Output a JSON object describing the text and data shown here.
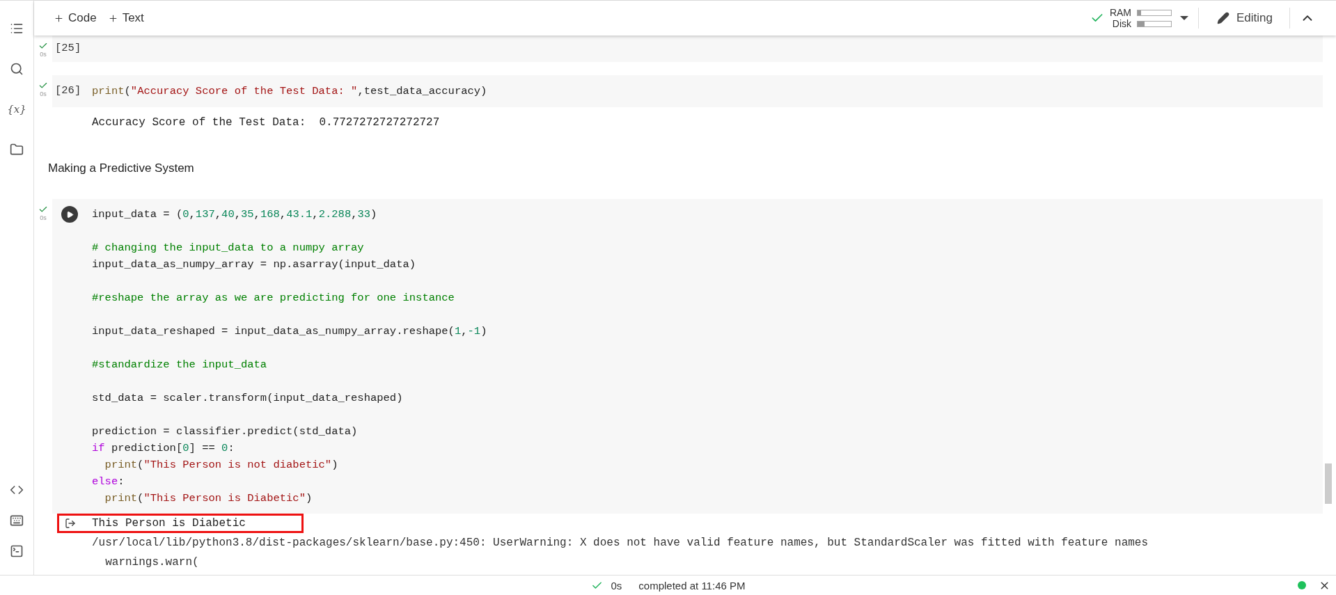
{
  "toolbar": {
    "add_buttons": [
      {
        "label": "Code"
      },
      {
        "label": "Text"
      }
    ],
    "meters": [
      {
        "label": "RAM",
        "level": 0.1
      },
      {
        "label": "Disk",
        "level": 0.2
      }
    ],
    "mode": "Editing"
  },
  "sidebar": {
    "top": [
      {
        "kind": "toc"
      },
      {
        "kind": "search"
      },
      {
        "kind": "variables",
        "label": "{x}"
      },
      {
        "kind": "files"
      }
    ],
    "bottom": [
      {
        "kind": "code"
      },
      {
        "kind": "command"
      },
      {
        "kind": "terminal"
      }
    ]
  },
  "cells": [
    {
      "kind": "code",
      "focused": false,
      "count": "[25]",
      "time": "0s"
    },
    {
      "kind": "code",
      "focused": false,
      "count": "[26]",
      "time": "0s",
      "lines": [
        {
          "spaced": false,
          "indented": false,
          "tokens": [
            {
              "kind": "f",
              "text": "print"
            },
            {
              "kind": "p",
              "text": "("
            },
            {
              "kind": "s",
              "text": "\"Accuracy Score of the Test Data: \""
            },
            {
              "kind": "p",
              "text": ",test_data_accuracy)"
            }
          ]
        }
      ],
      "outputs": [
        {
          "kind": "stdout",
          "highlighted": false,
          "text": "Accuracy Score of the Test Data:  0.7727272727272727"
        }
      ]
    },
    {
      "kind": "text",
      "text": "Making a Predictive System"
    },
    {
      "kind": "code",
      "focused": true,
      "time": "0s",
      "lines": [
        {
          "spaced": false,
          "indented": false,
          "tokens": [
            {
              "kind": "p",
              "text": "input_data = ("
            },
            {
              "kind": "n",
              "text": "0"
            },
            {
              "kind": "p",
              "text": ","
            },
            {
              "kind": "n",
              "text": "137"
            },
            {
              "kind": "p",
              "text": ","
            },
            {
              "kind": "n",
              "text": "40"
            },
            {
              "kind": "p",
              "text": ","
            },
            {
              "kind": "n",
              "text": "35"
            },
            {
              "kind": "p",
              "text": ","
            },
            {
              "kind": "n",
              "text": "168"
            },
            {
              "kind": "p",
              "text": ","
            },
            {
              "kind": "n",
              "text": "43.1"
            },
            {
              "kind": "p",
              "text": ","
            },
            {
              "kind": "n",
              "text": "2.288"
            },
            {
              "kind": "p",
              "text": ","
            },
            {
              "kind": "n",
              "text": "33"
            },
            {
              "kind": "p",
              "text": ")"
            }
          ]
        },
        {
          "spaced": true,
          "indented": false,
          "tokens": [
            {
              "kind": "c",
              "text": "# changing the input_data to a numpy array"
            }
          ]
        },
        {
          "spaced": false,
          "indented": false,
          "tokens": [
            {
              "kind": "p",
              "text": "input_data_as_numpy_array = np.asarray(input_data)"
            }
          ]
        },
        {
          "spaced": true,
          "indented": false,
          "tokens": [
            {
              "kind": "c",
              "text": "#reshape the array as we are predicting for one instance"
            }
          ]
        },
        {
          "spaced": true,
          "indented": false,
          "tokens": [
            {
              "kind": "p",
              "text": "input_data_reshaped = input_data_as_numpy_array.reshape("
            },
            {
              "kind": "n",
              "text": "1"
            },
            {
              "kind": "p",
              "text": ","
            },
            {
              "kind": "n",
              "text": "-1"
            },
            {
              "kind": "p",
              "text": ")"
            }
          ]
        },
        {
          "spaced": true,
          "indented": false,
          "tokens": [
            {
              "kind": "c",
              "text": "#standardize the input_data"
            }
          ]
        },
        {
          "spaced": true,
          "indented": false,
          "tokens": [
            {
              "kind": "p",
              "text": "std_data = scaler.transform(input_data_reshaped)"
            }
          ]
        },
        {
          "spaced": true,
          "indented": false,
          "tokens": [
            {
              "kind": "p",
              "text": "prediction = classifier.predict(std_data)"
            }
          ]
        },
        {
          "spaced": false,
          "indented": false,
          "tokens": [
            {
              "kind": "k",
              "text": "if"
            },
            {
              "kind": "p",
              "text": " prediction["
            },
            {
              "kind": "n",
              "text": "0"
            },
            {
              "kind": "p",
              "text": "] == "
            },
            {
              "kind": "n",
              "text": "0"
            },
            {
              "kind": "p",
              "text": ":"
            }
          ]
        },
        {
          "spaced": false,
          "indented": true,
          "tokens": [
            {
              "kind": "f",
              "text": "print"
            },
            {
              "kind": "p",
              "text": "("
            },
            {
              "kind": "s",
              "text": "\"This Person is not diabetic\""
            },
            {
              "kind": "p",
              "text": ")"
            }
          ]
        },
        {
          "spaced": false,
          "indented": false,
          "tokens": [
            {
              "kind": "k",
              "text": "else"
            },
            {
              "kind": "p",
              "text": ":"
            }
          ]
        },
        {
          "spaced": false,
          "indented": true,
          "tokens": [
            {
              "kind": "f",
              "text": "print"
            },
            {
              "kind": "p",
              "text": "("
            },
            {
              "kind": "s",
              "text": "\"This Person is Diabetic\""
            },
            {
              "kind": "p",
              "text": ")"
            }
          ]
        }
      ],
      "outputs": [
        {
          "kind": "stdout",
          "highlighted": true,
          "text": "This Person is Diabetic"
        },
        {
          "kind": "stderr",
          "highlighted": false,
          "text": "/usr/local/lib/python3.8/dist-packages/sklearn/base.py:450: UserWarning: X does not have valid feature names, but StandardScaler was fitted with feature names"
        },
        {
          "kind": "stderr",
          "highlighted": false,
          "text": "  warnings.warn("
        }
      ]
    }
  ],
  "status_bar": {
    "time": "0s",
    "message": "completed at 11:46 PM",
    "connected": true
  }
}
